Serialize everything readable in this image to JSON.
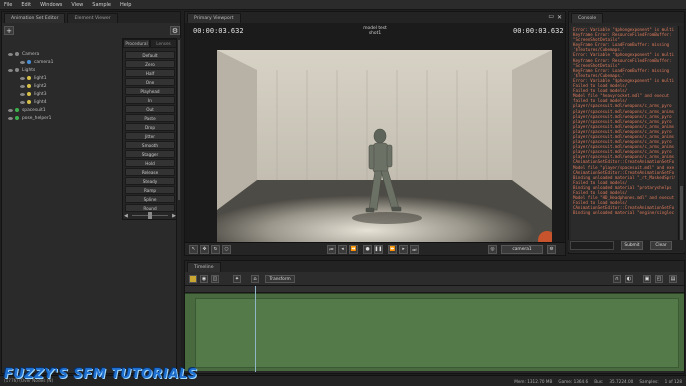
{
  "menubar": {
    "items": [
      "File",
      "Edit",
      "Windows",
      "View",
      "Sample",
      "Help"
    ]
  },
  "animation_set_editor": {
    "tabs": [
      "Animation Set Editor",
      "Element Viewer"
    ],
    "add_label": "+",
    "settings_label": "⚙",
    "tree": [
      {
        "label": "Camera",
        "depth": 0,
        "color": "#888888"
      },
      {
        "label": "camera1",
        "depth": 1,
        "color": "#4a90d9"
      },
      {
        "label": "Lights",
        "depth": 0,
        "color": "#888888"
      },
      {
        "label": "light1",
        "depth": 1,
        "color": "#d6c24a"
      },
      {
        "label": "light2",
        "depth": 1,
        "color": "#d6c24a"
      },
      {
        "label": "light3",
        "depth": 1,
        "color": "#d6c24a"
      },
      {
        "label": "light4",
        "depth": 1,
        "color": "#d6c24a"
      },
      {
        "label": "spacesuit1",
        "depth": 0,
        "color": "#3fb24f"
      },
      {
        "label": "pose_helper1",
        "depth": 0,
        "color": "#3fb24f"
      }
    ],
    "preset_tabs": [
      "Procedural",
      "Lenses"
    ],
    "presets": [
      "Default",
      "Zero",
      "Half",
      "One",
      "Playhead",
      "In",
      "Out",
      "Paste",
      "Drop",
      "Jitter",
      "Smooth",
      "Stagger",
      "Hold",
      "Release",
      "Steady",
      "Ramp",
      "Spline",
      "Round"
    ]
  },
  "viewport": {
    "tab": "Primary Viewport",
    "timecode_left": "00:00:03.632",
    "timecode_right": "00:00:03.632",
    "model_line1": "model test",
    "model_line2": "shot1",
    "camera_label": "camera1",
    "colors": {
      "floor": "#8d8a80",
      "wall": "#c9c4b6",
      "suit": "#6e7366"
    }
  },
  "console": {
    "tab": "Console",
    "lines": [
      "Error: Variable \"$phongexponent\" is multi",
      "Keyframe Error: ResourceFiledFromBuffer:",
      "\"ScreenShotDetails\"",
      "KeyFrame Error: LoadFromBuffer: missing",
      "'$Textures/Cubemaps.'",
      "Error: Variable \"$phongexponent\" is multi",
      "Keyframe Error: ResourceFiledFromBuffer:",
      "\"ScreenShotDetails\"",
      "KeyFrame Error: LoadFromBuffer: missing",
      "'$Textures/Cubemaps.'",
      "Error: Variable \"$phongexponent\" is multi",
      "Failed to load models/",
      "Failed to load models/",
      "Model file \"heavyrocket.mdl\" and execut",
      "failed to load models/",
      "player/spacesuit.mdl/weapons/c_arms_pyro",
      "player/spacesuit.mdl/weapons/c_arms_anims",
      "player/spacesuit.mdl/weapons/c_arms_pyro",
      "player/spacesuit.mdl/weapons/c_arms_pyro",
      "player/spacesuit.mdl/weapons/c_arms_anims",
      "player/spacesuit.mdl/weapons/c_arms_pyro",
      "player/spacesuit.mdl/weapons/c_arms_anims",
      "player/spacesuit.mdl/weapons/c_arms_pyro",
      "player/spacesuit.mdl/weapons/c_arms_anims",
      "player/spacesuit.mdl/weapons/c_arms_pyro",
      "player/spacesuit.mdl/weapons/c_arms_anims",
      "CAnimationSetEditor::CreateAnimationSetFo",
      "Model file \"player/spacesuit.mdl\" and exe",
      "CAnimationSetEditor::CreateAnimationSetFo",
      "Binding unloaded material \"_rt_MaskedSprit",
      "Failed to load models/",
      "Binding unloaded material \"protaryshelps",
      "Failed to load models/",
      "Model file \"HD_Headphones.mdl\" and execut",
      "Failed to load models/",
      "CAnimationSetEditor::CreateAnimationSetFo",
      "Binding unloaded material \"engine/singlec"
    ],
    "command_placeholder": "",
    "submit_label": "Submit",
    "clear_label": "Clear"
  },
  "timeline": {
    "tab": "Timeline",
    "transform_label": "Transform"
  },
  "status": {
    "left": "(1776) (Over Nodes (N)",
    "items": [
      "Mem: 1312.70 MB",
      "Game: 1364.6",
      "Bus:",
      "35.7224.00",
      "Samples:",
      "1 of 128"
    ]
  },
  "watermark": "FUZZY'S SFM TUTORIALS"
}
